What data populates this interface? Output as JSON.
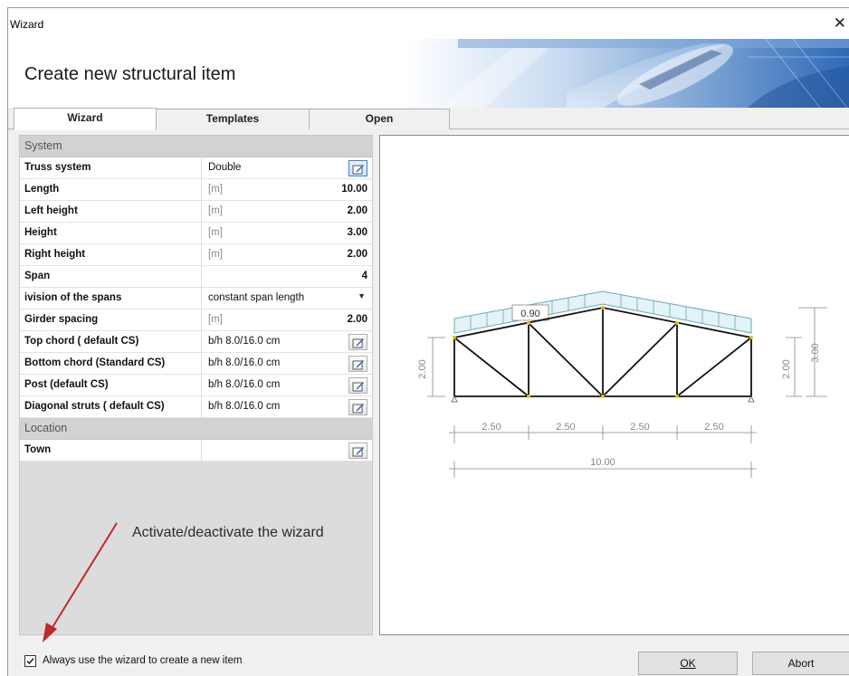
{
  "window": {
    "title": "Wizard",
    "close_glyph": "✕"
  },
  "banner": {
    "heading": "Create new structural item"
  },
  "tabs": [
    {
      "label": "Wizard",
      "active": true
    },
    {
      "label": "Templates",
      "active": false
    },
    {
      "label": "Open",
      "active": false
    }
  ],
  "properties": {
    "system_group": "System",
    "rows": [
      {
        "name": "Truss system",
        "value": "Double",
        "control": "edit-icon"
      },
      {
        "name": "Length",
        "unit": "[m]",
        "number": "10.00"
      },
      {
        "name": "Left height",
        "unit": "[m]",
        "number": "2.00"
      },
      {
        "name": "Height",
        "unit": "[m]",
        "number": "3.00"
      },
      {
        "name": "Right height",
        "unit": "[m]",
        "number": "2.00"
      },
      {
        "name": "Span",
        "number": "4"
      },
      {
        "name": "ivision of the spans",
        "value": "constant span length",
        "control": "dropdown"
      },
      {
        "name": "Girder spacing",
        "unit": "[m]",
        "number": "2.00"
      },
      {
        "name": "Top chord ( default CS)",
        "value": "b/h 8.0/16.0 cm",
        "control": "edit-icon"
      },
      {
        "name": "Bottom chord (Standard CS)",
        "value": "b/h 8.0/16.0 cm",
        "control": "edit-icon"
      },
      {
        "name": "Post (default CS)",
        "value": "b/h 8.0/16.0 cm",
        "control": "edit-icon"
      },
      {
        "name": "Diagonal struts ( default CS)",
        "value": "b/h 8.0/16.0 cm",
        "control": "edit-icon"
      }
    ],
    "location_group": "Location",
    "location_rows": [
      {
        "name": "Town",
        "value": "",
        "control": "edit-icon"
      }
    ]
  },
  "annotation": {
    "text": "Activate/deactivate the wizard",
    "arrow_color": "#c0282a"
  },
  "preview": {
    "load_label": "0.90",
    "left_height_dim": "2.00",
    "right_height_dim": "2.00",
    "total_height_dim": "3.00",
    "span_dims": [
      "2.50",
      "2.50",
      "2.50",
      "2.50"
    ],
    "length_dim": "10.00",
    "load_color": "#e3f3f7"
  },
  "footer": {
    "checkbox_label": "Always use the wizard to create a new item",
    "checkbox_checked": true,
    "ok_label": "OK",
    "abort_label": "Abort"
  }
}
